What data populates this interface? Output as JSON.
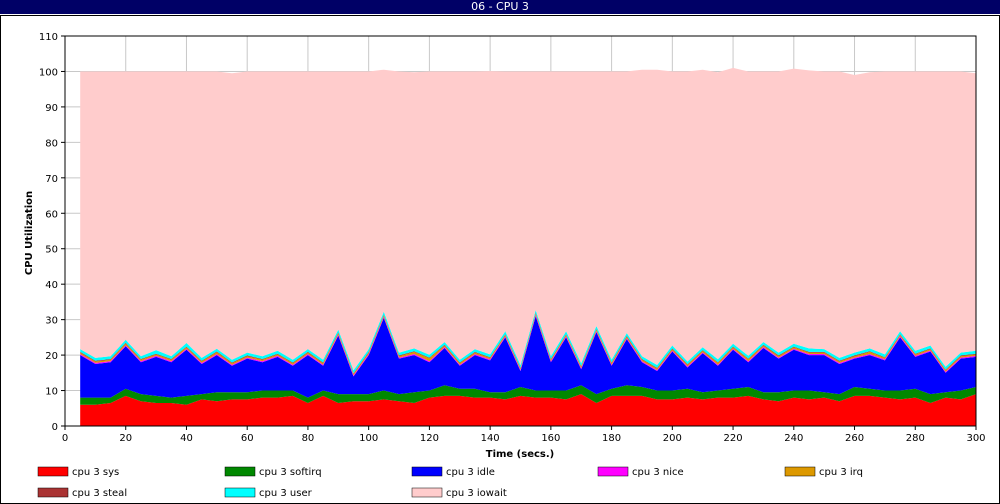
{
  "window": {
    "title": "06 - CPU 3"
  },
  "chart_data": {
    "type": "area",
    "stacked": true,
    "title": "",
    "xlabel": "Time (secs.)",
    "ylabel": "CPU Utilization",
    "xlim": [
      0,
      300
    ],
    "ylim": [
      0,
      110
    ],
    "xticks": [
      0,
      20,
      40,
      60,
      80,
      100,
      120,
      140,
      160,
      180,
      200,
      220,
      240,
      260,
      280,
      300
    ],
    "yticks": [
      0,
      10,
      20,
      30,
      40,
      50,
      60,
      70,
      80,
      90,
      100,
      110
    ],
    "grid": true,
    "legend_position": "bottom",
    "x": [
      5,
      10,
      15,
      20,
      25,
      30,
      35,
      40,
      45,
      50,
      55,
      60,
      65,
      70,
      75,
      80,
      85,
      90,
      95,
      100,
      105,
      110,
      115,
      120,
      125,
      130,
      135,
      140,
      145,
      150,
      155,
      160,
      165,
      170,
      175,
      180,
      185,
      190,
      195,
      200,
      205,
      210,
      215,
      220,
      225,
      230,
      235,
      240,
      245,
      250,
      255,
      260,
      265,
      270,
      275,
      280,
      285,
      290,
      295,
      300
    ],
    "series": [
      {
        "name": "cpu 3 sys",
        "color": "#ff0000",
        "values": [
          6,
          6,
          6.5,
          8.5,
          7,
          6.5,
          6.5,
          6,
          7.5,
          7,
          7.5,
          7.5,
          8,
          8,
          8.5,
          6.5,
          8.5,
          6.5,
          7,
          7,
          7.5,
          7,
          6.5,
          8,
          8.5,
          8.5,
          8,
          8,
          7.5,
          8.5,
          8,
          8,
          7.5,
          9,
          6.5,
          8.5,
          8.5,
          8.5,
          7.5,
          7.5,
          8,
          7.5,
          8,
          8,
          8.5,
          7.5,
          7,
          8,
          7.5,
          8,
          7,
          8.5,
          8.5,
          8,
          7.5,
          8,
          6.5,
          8,
          7.5,
          9
        ]
      },
      {
        "name": "cpu 3 softirq",
        "color": "#008800",
        "values": [
          2,
          2,
          1.5,
          2,
          2,
          2,
          1.5,
          2.5,
          1.5,
          2.5,
          2,
          2,
          2,
          2,
          1.5,
          1.5,
          1.5,
          2.5,
          2,
          2,
          2.5,
          2,
          3,
          2,
          3,
          2,
          2.5,
          1.5,
          2,
          2.5,
          2,
          2,
          2.5,
          2.5,
          2.5,
          2,
          3,
          2.5,
          2.5,
          2.5,
          2.5,
          2,
          2,
          2.5,
          2.5,
          2,
          2.5,
          2,
          2.5,
          1.5,
          2,
          2.5,
          2,
          2,
          2.5,
          2.5,
          2.5,
          1.5,
          2.5,
          2
        ]
      },
      {
        "name": "cpu 3 idle",
        "color": "#0000ff",
        "values": [
          12,
          9.5,
          10,
          12,
          9,
          11,
          10,
          13,
          8.5,
          10.5,
          7.5,
          9.5,
          8,
          9.5,
          7,
          12,
          7,
          16.5,
          5,
          11,
          20.5,
          10,
          10.5,
          8,
          10.5,
          6.5,
          9.5,
          9,
          15.5,
          4.5,
          21,
          8,
          15,
          4.5,
          17.5,
          6.5,
          13,
          7,
          5.5,
          11,
          6,
          11,
          7,
          11,
          7,
          12.5,
          9.5,
          11.5,
          10,
          10.5,
          8.5,
          8,
          9.5,
          8.5,
          15,
          9,
          12,
          5.5,
          9,
          8.5
        ]
      },
      {
        "name": "cpu 3 nice",
        "color": "#ff00ff",
        "values": [
          0.3,
          0.3,
          0.3,
          0.3,
          0.3,
          0.3,
          0.3,
          0.3,
          0.3,
          0.3,
          0.3,
          0.3,
          0.3,
          0.3,
          0.3,
          0.3,
          0.3,
          0.3,
          0.3,
          0.3,
          0.3,
          0.3,
          0.3,
          0.3,
          0.3,
          0.3,
          0.3,
          0.3,
          0.3,
          0.3,
          0.3,
          0.3,
          0.3,
          0.3,
          0.3,
          0.3,
          0.3,
          0.3,
          0.3,
          0.3,
          0.3,
          0.3,
          0.3,
          0.3,
          0.3,
          0.3,
          0.3,
          0.3,
          0.3,
          0.3,
          0.3,
          0.3,
          0.3,
          0.3,
          0.3,
          0.3,
          0.3,
          0.3,
          0.3,
          0.3
        ]
      },
      {
        "name": "cpu 3 irq",
        "color": "#dd9900",
        "values": [
          0.4,
          0.4,
          0.4,
          0.5,
          0.4,
          0.4,
          0.4,
          0.4,
          0.4,
          0.5,
          0.4,
          0.4,
          0.4,
          0.4,
          0.4,
          0.4,
          0.4,
          0.4,
          0.4,
          0.4,
          0.4,
          0.4,
          0.6,
          0.8,
          0.4,
          0.4,
          0.4,
          0.4,
          0.4,
          0.4,
          0.4,
          0.4,
          0.4,
          0.4,
          0.4,
          0.4,
          0.4,
          0.4,
          0.4,
          0.4,
          0.4,
          0.4,
          0.5,
          0.4,
          0.5,
          0.4,
          0.4,
          0.4,
          0.4,
          0.4,
          0.4,
          0.4,
          0.6,
          0.4,
          0.4,
          0.4,
          0.4,
          0.4,
          0.4,
          0.4
        ]
      },
      {
        "name": "cpu 3 steal",
        "color": "#aa3333",
        "values": [
          0.2,
          0.2,
          0.2,
          0.2,
          0.2,
          0.2,
          0.2,
          0.2,
          0.2,
          0.2,
          0.2,
          0.2,
          0.2,
          0.2,
          0.2,
          0.2,
          0.2,
          0.2,
          0.2,
          0.2,
          0.2,
          0.2,
          0.2,
          0.2,
          0.2,
          0.2,
          0.2,
          0.2,
          0.2,
          0.2,
          0.2,
          0.2,
          0.2,
          0.2,
          0.2,
          0.2,
          0.2,
          0.2,
          0.2,
          0.2,
          0.2,
          0.2,
          0.2,
          0.2,
          0.2,
          0.2,
          0.2,
          0.2,
          0.2,
          0.2,
          0.2,
          0.2,
          0.2,
          0.2,
          0.2,
          0.2,
          0.2,
          0.2,
          0.2,
          0.2
        ]
      },
      {
        "name": "cpu 3 user",
        "color": "#00ffff",
        "values": [
          0.8,
          0.8,
          0.8,
          0.8,
          0.8,
          1,
          0.8,
          1,
          0.8,
          0.8,
          0.8,
          0.8,
          0.8,
          0.8,
          0.8,
          0.8,
          0.8,
          0.8,
          0.8,
          0.8,
          0.8,
          0.8,
          0.8,
          0.8,
          0.8,
          0.8,
          0.8,
          0.8,
          0.8,
          0.8,
          0.8,
          0.8,
          0.8,
          0.8,
          0.8,
          0.8,
          0.8,
          0.8,
          0.8,
          0.8,
          0.8,
          0.8,
          0.8,
          0.8,
          0.8,
          0.8,
          0.8,
          0.8,
          1,
          0.8,
          0.8,
          0.8,
          0.8,
          0.8,
          0.8,
          0.8,
          0.8,
          0.8,
          0.8,
          0.8
        ]
      },
      {
        "name": "cpu 3 iowait",
        "color": "#ffcccc",
        "values": [
          78.3,
          80.8,
          80.3,
          75.7,
          80.3,
          78.6,
          80.3,
          76.6,
          80.8,
          78.2,
          80.8,
          79.3,
          80.3,
          78.8,
          81.3,
          78.3,
          81.3,
          72.8,
          84.3,
          78.3,
          68.3,
          79.3,
          77.9,
          79.9,
          76.3,
          81.3,
          78.3,
          79.9,
          73.3,
          82.8,
          67.3,
          80.3,
          73.3,
          82.3,
          71.8,
          81.3,
          73.8,
          80.8,
          83.3,
          77.3,
          81.8,
          78.3,
          81,
          77.8,
          80.2,
          76.3,
          79.3,
          77.6,
          78.4,
          78.3,
          80.8,
          78.3,
          77.9,
          79.8,
          73.3,
          78.8,
          77.3,
          83.3,
          79.3,
          78.3
        ]
      }
    ]
  }
}
